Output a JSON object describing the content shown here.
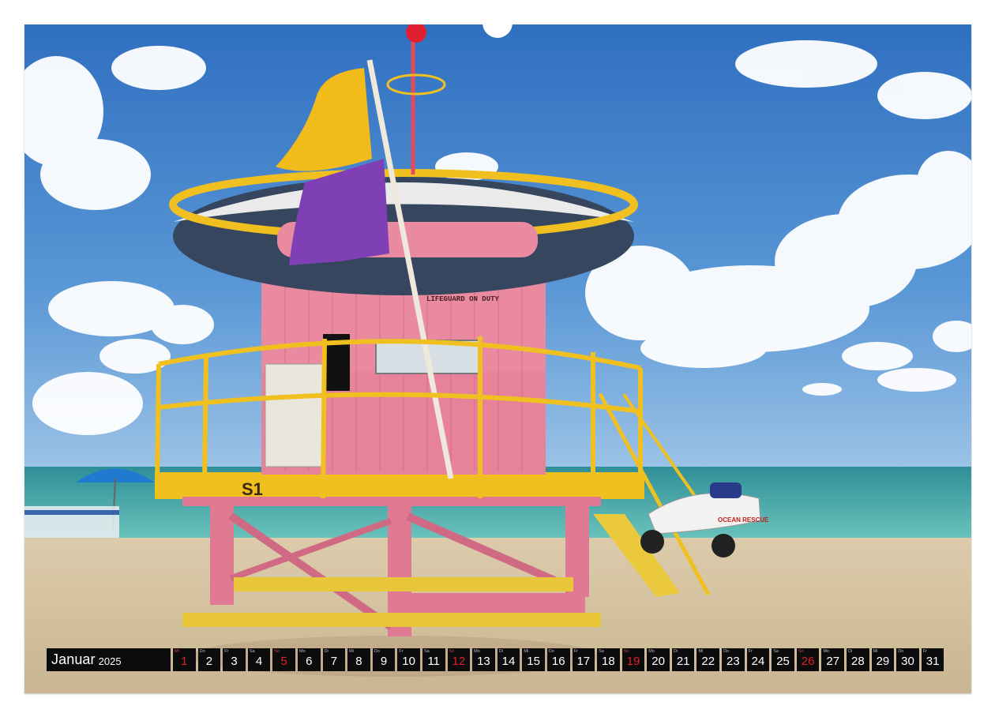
{
  "calendar": {
    "month": "Januar",
    "year": "2025",
    "days": [
      {
        "wd": "Mi",
        "d": "1",
        "sun": true
      },
      {
        "wd": "Do",
        "d": "2"
      },
      {
        "wd": "Fr",
        "d": "3"
      },
      {
        "wd": "Sa",
        "d": "4"
      },
      {
        "wd": "So",
        "d": "5",
        "sun": true
      },
      {
        "wd": "Mo",
        "d": "6"
      },
      {
        "wd": "Di",
        "d": "7"
      },
      {
        "wd": "Mi",
        "d": "8"
      },
      {
        "wd": "Do",
        "d": "9"
      },
      {
        "wd": "Fr",
        "d": "10"
      },
      {
        "wd": "Sa",
        "d": "11"
      },
      {
        "wd": "So",
        "d": "12",
        "sun": true
      },
      {
        "wd": "Mo",
        "d": "13"
      },
      {
        "wd": "Di",
        "d": "14"
      },
      {
        "wd": "Mi",
        "d": "15"
      },
      {
        "wd": "Do",
        "d": "16"
      },
      {
        "wd": "Fr",
        "d": "17"
      },
      {
        "wd": "Sa",
        "d": "18"
      },
      {
        "wd": "So",
        "d": "19",
        "sun": true
      },
      {
        "wd": "Mo",
        "d": "20"
      },
      {
        "wd": "Di",
        "d": "21"
      },
      {
        "wd": "Mi",
        "d": "22"
      },
      {
        "wd": "Do",
        "d": "23"
      },
      {
        "wd": "Fr",
        "d": "24"
      },
      {
        "wd": "Sa",
        "d": "25"
      },
      {
        "wd": "So",
        "d": "26",
        "sun": true
      },
      {
        "wd": "Mo",
        "d": "27"
      },
      {
        "wd": "Di",
        "d": "28"
      },
      {
        "wd": "Mi",
        "d": "29"
      },
      {
        "wd": "Do",
        "d": "30"
      },
      {
        "wd": "Fr",
        "d": "31"
      }
    ]
  },
  "photo": {
    "tower_number": "S1",
    "tower_sign": "LIFEGUARD ON DUTY",
    "jetski_text": "OCEAN RESCUE"
  },
  "colors": {
    "sky": "#3f7fc9",
    "sand": "#d9c7a6",
    "sea": "#4fb3b0",
    "tower_pink": "#e8788f",
    "rail_yellow": "#f0c020",
    "sunday_red": "#e0202a"
  }
}
